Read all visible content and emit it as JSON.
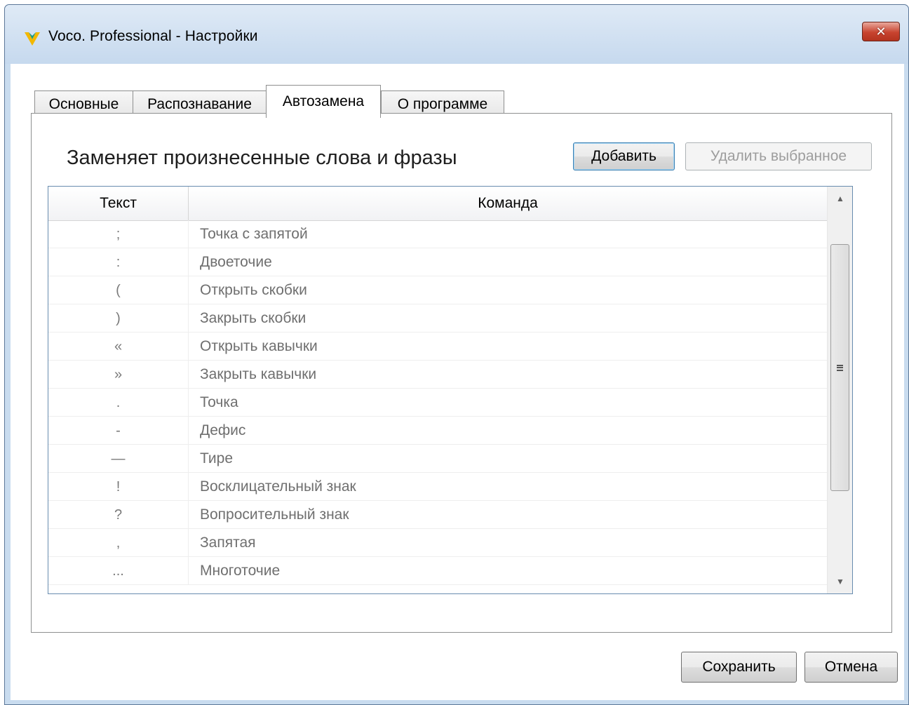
{
  "window": {
    "title": "Voco. Professional - Настройки",
    "close_label": "✕"
  },
  "tabs": [
    {
      "label": "Основные",
      "active": false
    },
    {
      "label": "Распознавание",
      "active": false
    },
    {
      "label": "Автозамена",
      "active": true
    },
    {
      "label": "О программе",
      "active": false
    }
  ],
  "autoreplace": {
    "heading": "Заменяет произнесенные слова и фразы",
    "add_button": "Добавить",
    "delete_button": "Удалить выбранное",
    "columns": {
      "text": "Текст",
      "command": "Команда"
    },
    "rows": [
      {
        "text": ";",
        "command": "Точка с запятой"
      },
      {
        "text": ":",
        "command": "Двоеточие"
      },
      {
        "text": "(",
        "command": "Открыть скобки"
      },
      {
        "text": ")",
        "command": "Закрыть скобки"
      },
      {
        "text": "«",
        "command": "Открыть кавычки"
      },
      {
        "text": "»",
        "command": "Закрыть кавычки"
      },
      {
        "text": ".",
        "command": "Точка"
      },
      {
        "text": "-",
        "command": "Дефис"
      },
      {
        "text": "—",
        "command": "Тире"
      },
      {
        "text": "!",
        "command": "Восклицательный знак"
      },
      {
        "text": "?",
        "command": "Вопросительный знак"
      },
      {
        "text": ",",
        "command": "Запятая"
      },
      {
        "text": "...",
        "command": "Многоточие"
      }
    ]
  },
  "footer": {
    "save_button": "Сохранить",
    "cancel_button": "Отмена"
  },
  "colors": {
    "titlebar": "#c6d9ee",
    "close_button": "#c8432f",
    "grid_border": "#688caf",
    "default_button_border": "#3c7fb1"
  },
  "icons": {
    "app": "voco-v-icon",
    "scroll_up": "scroll-up-arrow-icon",
    "scroll_down": "scroll-down-arrow-icon"
  }
}
